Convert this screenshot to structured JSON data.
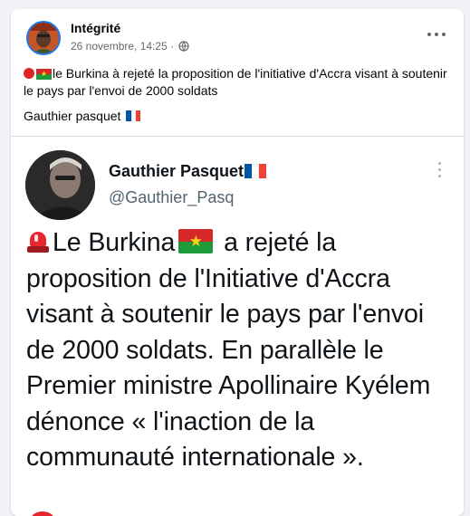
{
  "post": {
    "author": "Intégrité",
    "timestamp": "26 novembre, 14:25",
    "separator": "·",
    "text_part1": "le Burkina à rejeté la proposition de l'initiative d'Accra visant à soutenir le pays par l'envoi de 2000 soldats",
    "signature": "Gauthier pasquet"
  },
  "tweet": {
    "display_name": "Gauthier Pasquet",
    "handle": "@Gauthier_Pasq",
    "text_before_flag": "Le Burkina",
    "text_after_flag": " a rejeté la proposition de l'Initiative d'Accra visant à soutenir le pays par l'envoi de 2000 soldats. En parallèle le Premier ministre Apollinaire Kyélem dénonce « l'inaction de la communauté internationale »."
  },
  "icons": {
    "more": "more-horizontal-icon",
    "globe": "globe-icon",
    "tweet_more": "more-vertical-icon",
    "siren": "rotating-light-icon",
    "flag_bf": "burkina-faso-flag-icon",
    "flag_fr": "france-flag-icon"
  },
  "colors": {
    "background": "#f0f2f5",
    "card": "#ffffff",
    "meta_text": "#65676b",
    "tweet_handle": "#536471",
    "avatar_ring": "#1877f2",
    "bf_red": "#d62828",
    "bf_green": "#1e9a3a",
    "bf_star": "#f7d51d",
    "fr_blue": "#0055a4",
    "fr_red": "#ef4135"
  }
}
